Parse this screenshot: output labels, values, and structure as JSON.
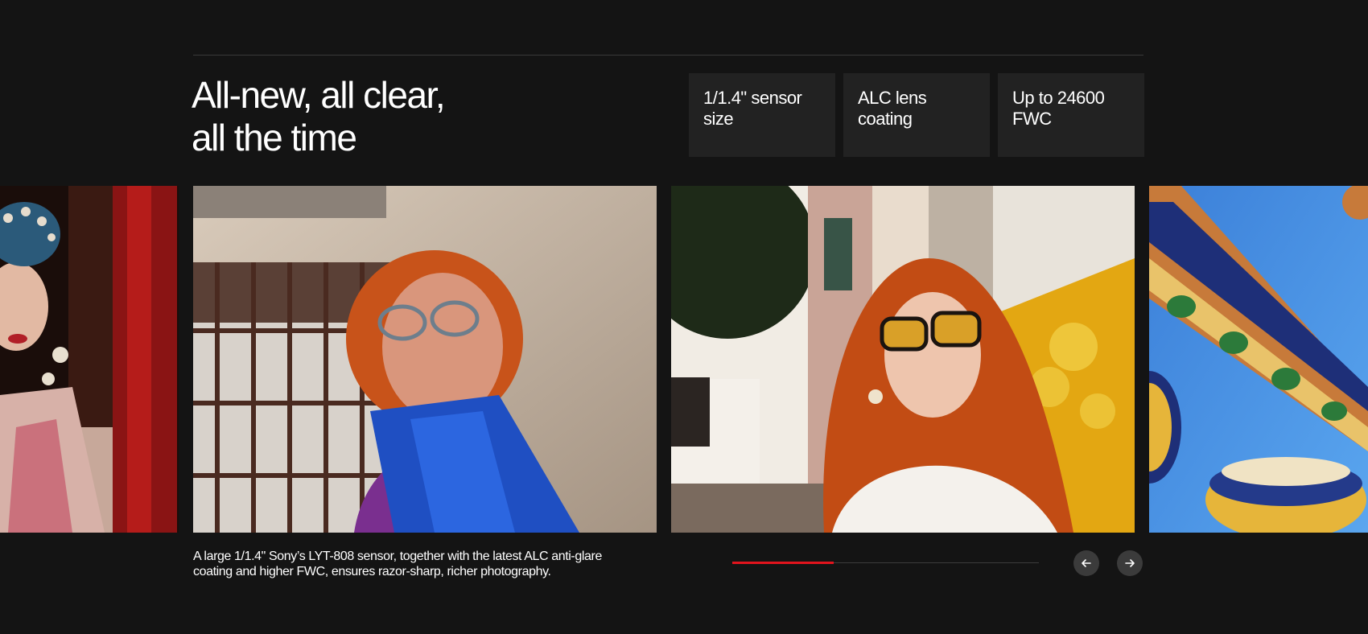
{
  "section": {
    "headline_line1": "All-new, all clear,",
    "headline_line2": "all the time",
    "specs": [
      {
        "label": "1/1.4\" sensor size"
      },
      {
        "label": "ALC lens coating"
      },
      {
        "label": "Up to 24600 FWC"
      }
    ],
    "caption": "A large 1/1.4\" Sony’s LYT-808 sensor, together with the latest ALC anti-glare coating and higher FWC, ensures razor-sharp, richer photography."
  },
  "carousel": {
    "progress": 0.33,
    "accent_color": "#e2141d",
    "slides": [
      {
        "subject": "opera-performer-photo"
      },
      {
        "subject": "red-haired-woman-blue-scarf-photo"
      },
      {
        "subject": "red-haired-woman-sunglasses-photo"
      },
      {
        "subject": "ornate-tiled-column-photo"
      }
    ],
    "prev_icon": "arrow-left-icon",
    "next_icon": "arrow-right-icon"
  }
}
